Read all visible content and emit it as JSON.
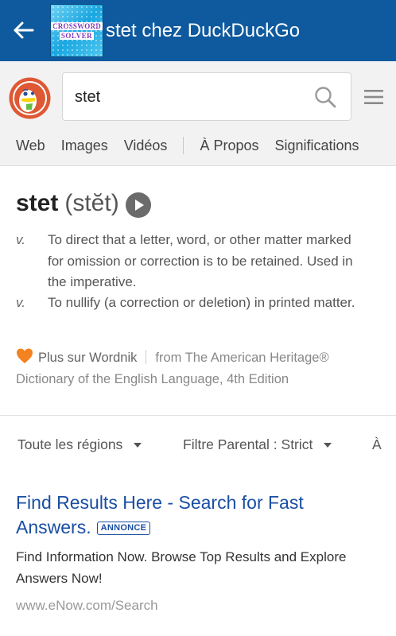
{
  "appbar": {
    "title": "stet chez DuckDuckGo",
    "app_icon": {
      "name": "crossword-solver-icon",
      "line1": "CROSSWORD",
      "line2": "SOLVER"
    }
  },
  "search": {
    "query": "stet",
    "icons": {
      "logo": "duckduckgo-logo",
      "search": "search-icon",
      "menu": "hamburger-menu-icon"
    }
  },
  "tabs": [
    "Web",
    "Images",
    "Vidéos",
    "À Propos",
    "Significations"
  ],
  "definition": {
    "word": "stet",
    "pronunciation": "(stĕt)",
    "senses": [
      {
        "pos": "v.",
        "text": "To direct that a letter, word, or other matter marked for omission or correction is to be retained. Used in the imperative."
      },
      {
        "pos": "v.",
        "text": "To nullify (a correction or deletion) in printed matter."
      }
    ],
    "source_link": "Plus sur Wordnik",
    "source_text": "from The American Heritage® Dictionary of the English Language, 4th Edition"
  },
  "filters": {
    "region": "Toute les régions",
    "safe_search": "Filtre Parental : Strict",
    "time": "À"
  },
  "result": {
    "title": "Find Results Here - Search for Fast Answers.",
    "badge": "ANNONCE",
    "snippet": "Find Information Now. Browse Top Results and Explore Answers Now!",
    "url": "www.eNow.com/Search"
  },
  "colors": {
    "appbar": "#0f5a9e",
    "link": "#1a4ea3",
    "ddg_orange": "#de5833"
  }
}
